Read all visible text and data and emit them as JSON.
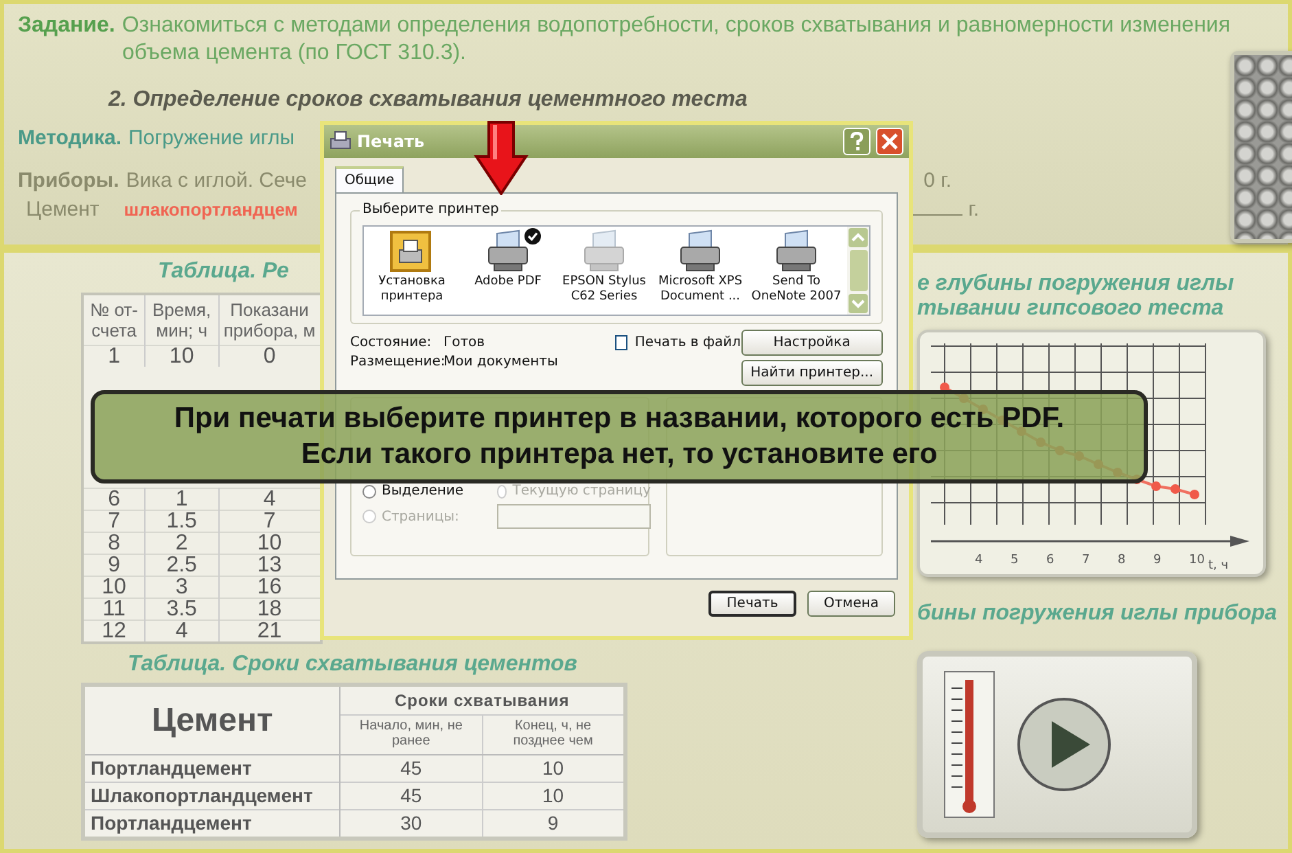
{
  "task": {
    "label": "Задание.",
    "lines": [
      "Ознакомиться с методами определения водопотребности, сроков схватывания и равномерности изменения",
      "объема цемента (по ГОСТ 310.3)."
    ]
  },
  "section_title": "2. Определение сроков схватывания цементного теста",
  "method": {
    "label": "Методика.",
    "text": "Погружение иглы"
  },
  "devices": {
    "label": "Приборы.",
    "text": "Вика с иглой. Сече",
    "tail": "0 г."
  },
  "cement": {
    "label": "Цемент",
    "value": "шлакопортландцем",
    "tail": "г."
  },
  "results_table": {
    "title": "Таблица. Ре",
    "columns": [
      "№ от-счета",
      "Время, мин; ч",
      "Показани прибора, м"
    ],
    "rows_above_banner": [
      [
        "1",
        "10",
        "0"
      ]
    ],
    "rows_below_banner": [
      [
        "6",
        "1",
        "4"
      ],
      [
        "7",
        "1.5",
        "7"
      ],
      [
        "8",
        "2",
        "10"
      ],
      [
        "9",
        "2.5",
        "13"
      ],
      [
        "10",
        "3",
        "16"
      ],
      [
        "11",
        "3.5",
        "18"
      ],
      [
        "12",
        "4",
        "21"
      ]
    ]
  },
  "cement_table": {
    "title": "Таблица. Сроки схватывания цементов",
    "header": "Цемент",
    "group_header": "Сроки схватывания",
    "columns": [
      "",
      "Начало, мин, не ранее",
      "Конец, ч, не позднее чем"
    ],
    "rows": [
      [
        "Портландцемент",
        "45",
        "10"
      ],
      [
        "Шлакопортландцемент",
        "45",
        "10"
      ],
      [
        "Портландцемент",
        "30",
        "9"
      ]
    ]
  },
  "chart_panel": {
    "title_lines": [
      "е глубины погружения иглы",
      "тывании гипсового теста"
    ],
    "x_tick_labels": [
      "4",
      "5",
      "6",
      "7",
      "8",
      "9",
      "10"
    ],
    "x_axis_label": "t, ч",
    "caption": "бины погружения иглы  прибора"
  },
  "print_dialog": {
    "title": "Печать",
    "tabs": [
      {
        "label": "Общие",
        "selected": true
      }
    ],
    "printer_group": "Выберите принтер",
    "printers": [
      {
        "label_lines": [
          "Установка",
          "принтера"
        ],
        "kind": "add",
        "default": false
      },
      {
        "label_lines": [
          "Adobe PDF"
        ],
        "kind": "printer",
        "default": true
      },
      {
        "label_lines": [
          "EPSON Stylus",
          "C62 Series"
        ],
        "kind": "offline",
        "default": false
      },
      {
        "label_lines": [
          "Microsoft XPS",
          "Document ..."
        ],
        "kind": "printer",
        "default": false
      },
      {
        "label_lines": [
          "Send To",
          "OneNote 2007"
        ],
        "kind": "printer",
        "default": false
      }
    ],
    "info": [
      {
        "label": "Состояние:",
        "value": "Готов"
      },
      {
        "label": "Размещение:",
        "value": "Мои документы"
      }
    ],
    "print_to_file": {
      "label": "Печать в файл",
      "checked": false
    },
    "setup_button": "Настройка",
    "find_button": "Найти принтер...",
    "page_range": {
      "options": [
        {
          "label": "Выделение",
          "selected": false,
          "disabled": false
        },
        {
          "label": "Текущую страницу",
          "selected": false,
          "disabled": true
        },
        {
          "label": "Страницы:",
          "selected": false,
          "disabled": true
        }
      ]
    },
    "actions": [
      {
        "label": "Печать",
        "default": true
      },
      {
        "label": "Отмена",
        "default": false
      }
    ]
  },
  "banner": {
    "lines": [
      "При печати выберите принтер в названии, которого есть PDF.",
      "Если такого принтера нет, то установите его"
    ]
  }
}
